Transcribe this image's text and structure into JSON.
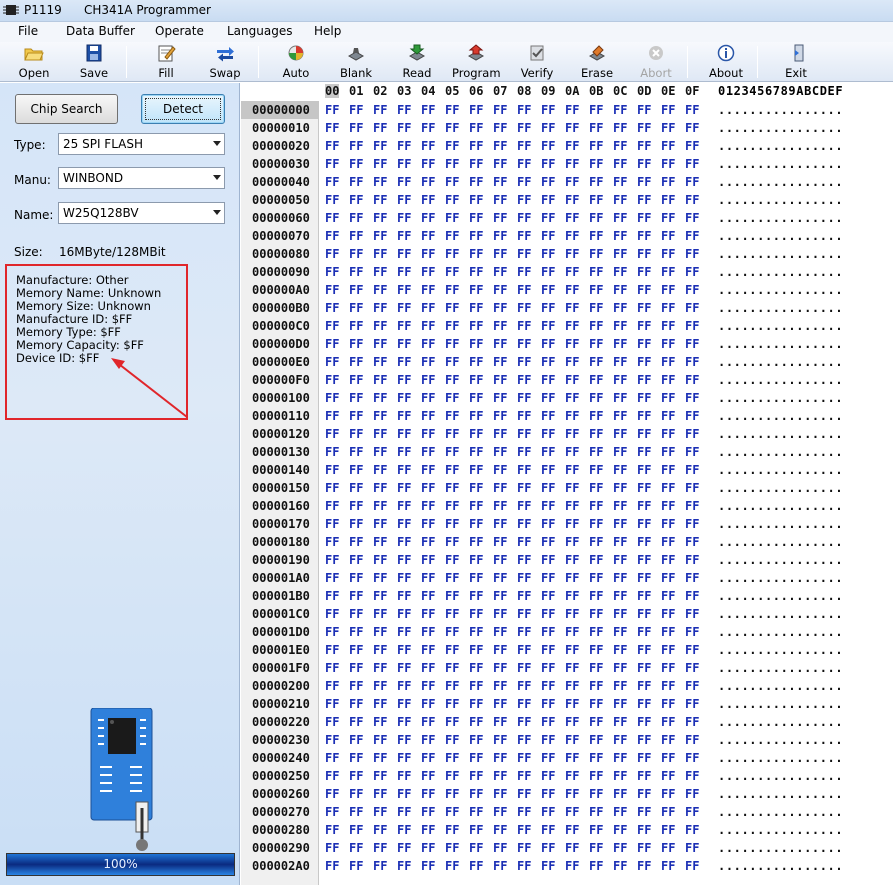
{
  "window": {
    "title_id": "P1119",
    "title_app": "CH341A Programmer"
  },
  "menu": [
    "File",
    "Data Buffer",
    "Operate",
    "Languages",
    "Help"
  ],
  "toolbar": [
    {
      "label": "Open",
      "icon": "open-folder-icon",
      "enabled": true
    },
    {
      "label": "Save",
      "icon": "save-disk-icon",
      "enabled": true
    },
    {
      "label": "Fill",
      "icon": "fill-pencil-icon",
      "enabled": true
    },
    {
      "label": "Swap",
      "icon": "swap-arrows-icon",
      "enabled": true
    },
    {
      "label": "Auto",
      "icon": "auto-icon",
      "enabled": true
    },
    {
      "label": "Blank",
      "icon": "blank-chip-icon",
      "enabled": true
    },
    {
      "label": "Read",
      "icon": "read-chip-icon",
      "enabled": true
    },
    {
      "label": "Program",
      "icon": "program-chip-icon",
      "enabled": true
    },
    {
      "label": "Verify",
      "icon": "verify-chip-icon",
      "enabled": true
    },
    {
      "label": "Erase",
      "icon": "erase-chip-icon",
      "enabled": true
    },
    {
      "label": "Abort",
      "icon": "abort-icon",
      "enabled": false
    },
    {
      "label": "About",
      "icon": "info-icon",
      "enabled": true
    },
    {
      "label": "Exit",
      "icon": "exit-door-icon",
      "enabled": true
    }
  ],
  "left": {
    "chip_search_label": "Chip Search",
    "detect_label": "Detect",
    "type_label": "Type:",
    "type_value": "25 SPI FLASH",
    "manu_label": "Manu:",
    "manu_value": "WINBOND",
    "name_label": "Name:",
    "name_value": "W25Q128BV",
    "size_label": "Size:",
    "size_value": "16MByte/128MBit",
    "info": [
      "Manufacture: Other",
      "Memory Name: Unknown",
      "Memory Size: Unknown",
      "Manufacture ID: $FF",
      "Memory Type: $FF",
      "Memory Capacity: $FF",
      "Device ID: $FF"
    ],
    "annotation_color": "#e0262b",
    "progress": {
      "value": 1.0,
      "text": "100%"
    }
  },
  "hex": {
    "column_headers": [
      "00",
      "01",
      "02",
      "03",
      "04",
      "05",
      "06",
      "07",
      "08",
      "09",
      "0A",
      "0B",
      "0C",
      "0D",
      "0E",
      "0F"
    ],
    "ascii_header": "0123456789ABCDEF",
    "byte_value": "FF",
    "ascii_row": "................",
    "byte_color": "#1b2fb5",
    "addresses": [
      "00000000",
      "00000010",
      "00000020",
      "00000030",
      "00000040",
      "00000050",
      "00000060",
      "00000070",
      "00000080",
      "00000090",
      "000000A0",
      "000000B0",
      "000000C0",
      "000000D0",
      "000000E0",
      "000000F0",
      "00000100",
      "00000110",
      "00000120",
      "00000130",
      "00000140",
      "00000150",
      "00000160",
      "00000170",
      "00000180",
      "00000190",
      "000001A0",
      "000001B0",
      "000001C0",
      "000001D0",
      "000001E0",
      "000001F0",
      "00000200",
      "00000210",
      "00000220",
      "00000230",
      "00000240",
      "00000250",
      "00000260",
      "00000270",
      "00000280",
      "00000290",
      "000002A0"
    ]
  }
}
